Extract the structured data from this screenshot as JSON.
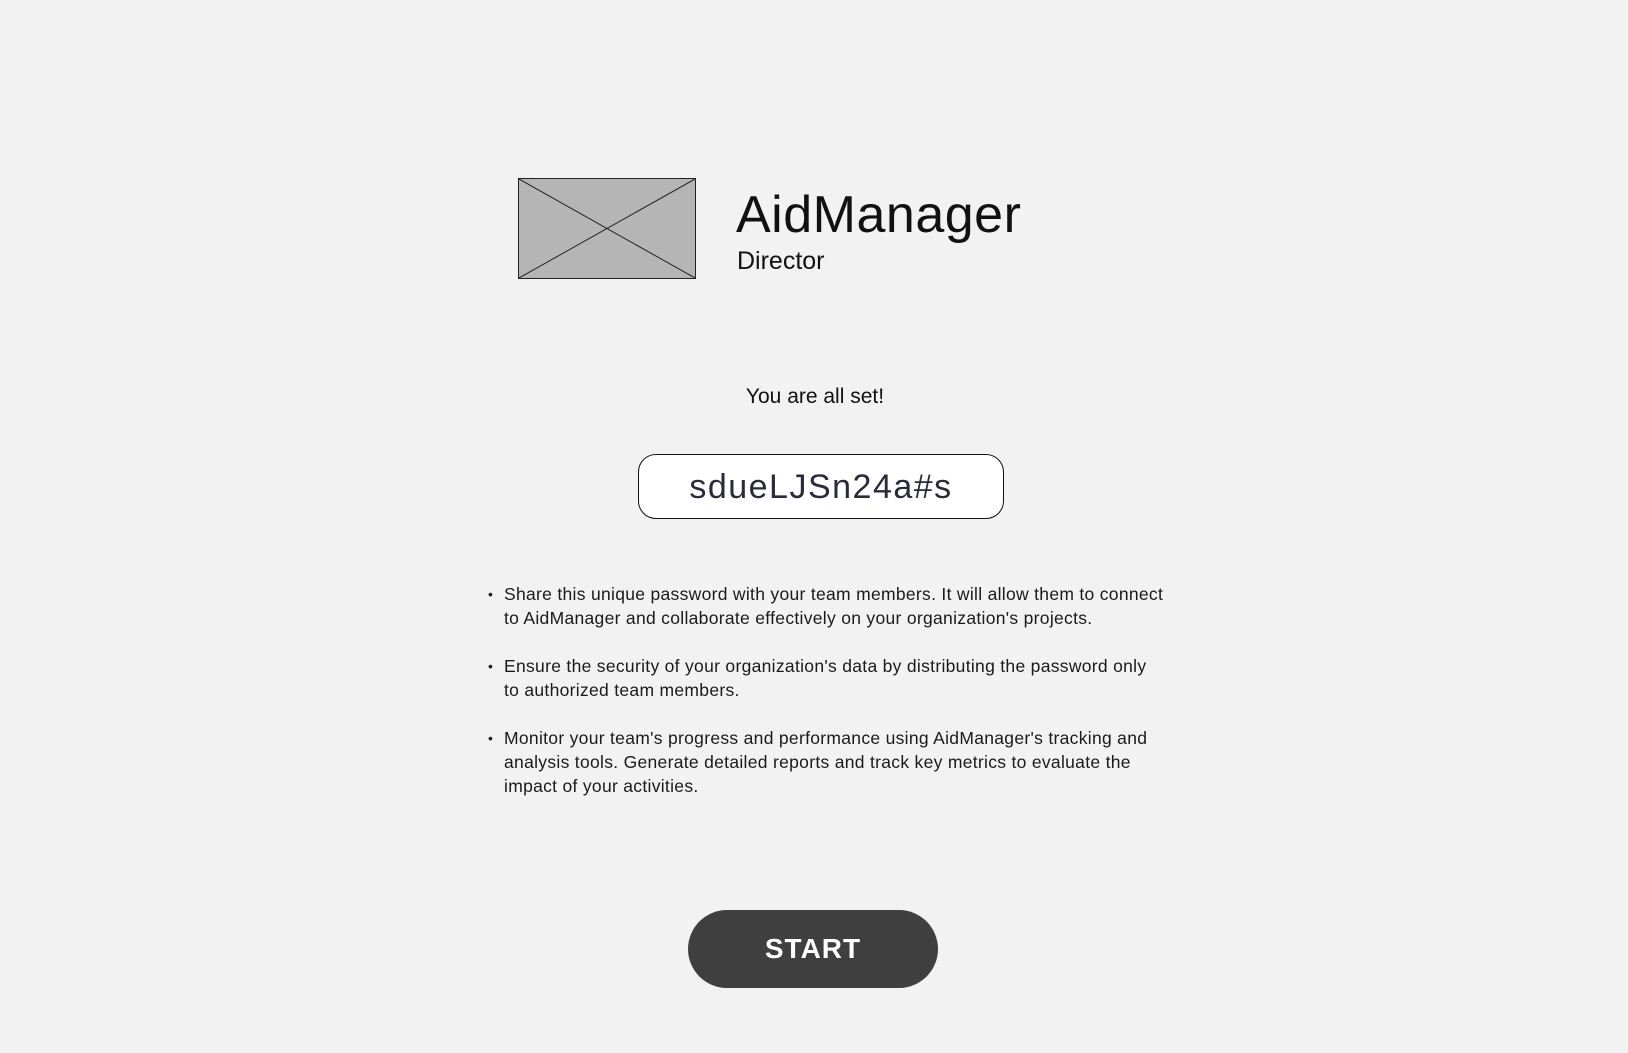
{
  "header": {
    "logo_icon": "image-placeholder-icon",
    "app_name": "AidManager",
    "role": "Director"
  },
  "main": {
    "status_message": "You are all set!",
    "password": "sdueLJSn24a#s",
    "info_items": [
      "Share this unique password with your team members. It will allow them to connect to AidManager and collaborate effectively on your organization's projects.",
      "Ensure the security of your organization's data by distributing the password only to authorized team members.",
      "Monitor your team's progress and performance using AidManager's tracking and analysis tools. Generate detailed reports and track key metrics to evaluate the impact of your activities."
    ],
    "bullet": "•"
  },
  "actions": {
    "start_label": "START"
  },
  "colors": {
    "background": "#f2f2f2",
    "placeholder_fill": "#b5b5b5",
    "button_fill": "#3f3f3f",
    "button_text": "#ffffff",
    "password_text": "#2a2a3a"
  }
}
